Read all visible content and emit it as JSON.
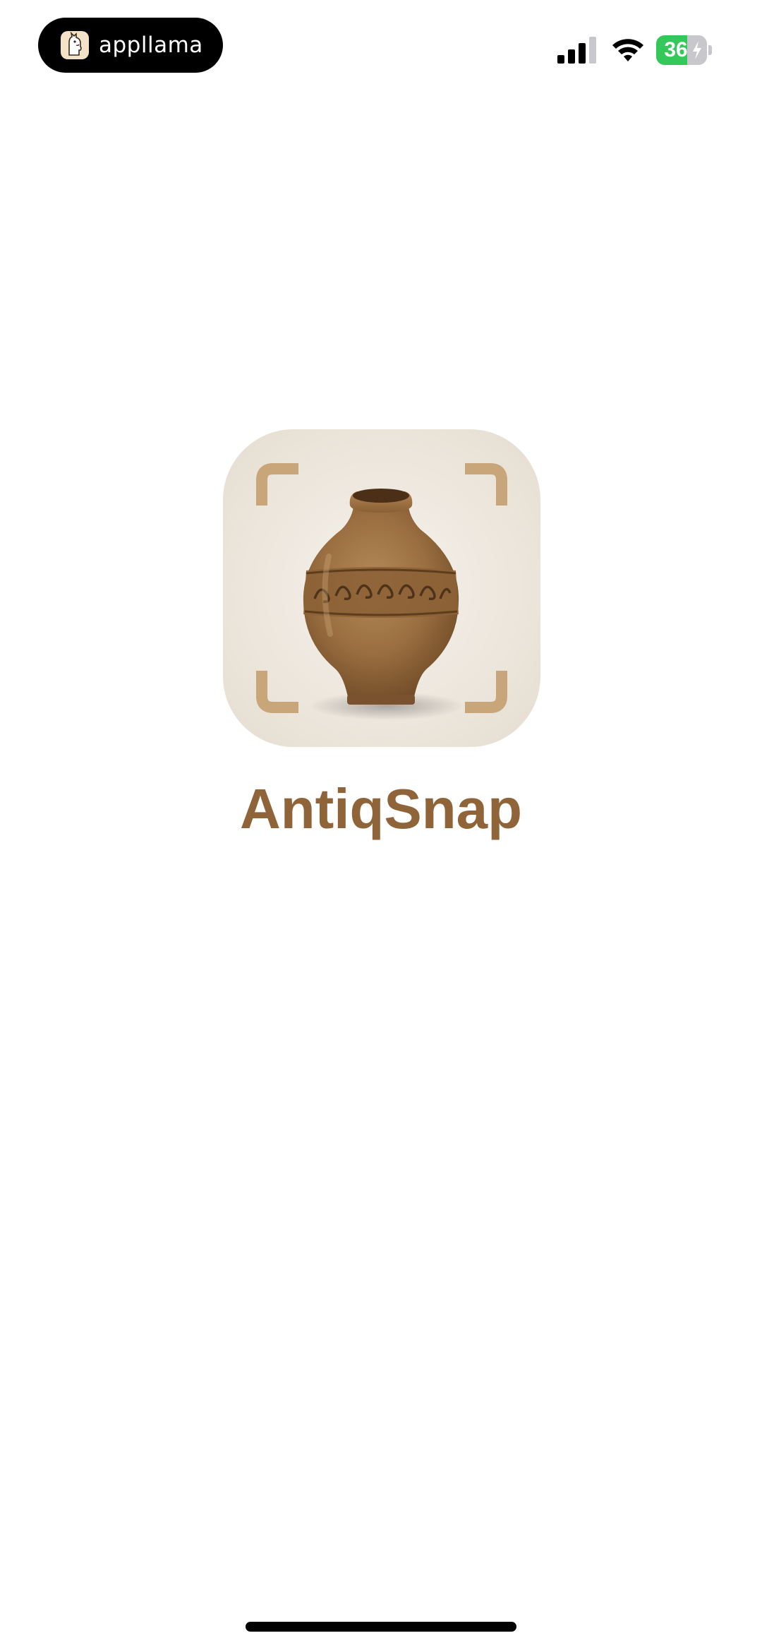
{
  "status_bar": {
    "badge_text": "appllama",
    "badge_logo_icon": "llama-icon",
    "signal_icon": "cellular-signal-icon",
    "wifi_icon": "wifi-icon",
    "battery_level": "36",
    "battery_charging": true
  },
  "splash": {
    "app_icon": "vase-scan-icon",
    "app_name": "AntiqSnap"
  },
  "colors": {
    "title": "#8f6438",
    "bracket": "#c9a57a",
    "battery_green": "#34c759"
  }
}
